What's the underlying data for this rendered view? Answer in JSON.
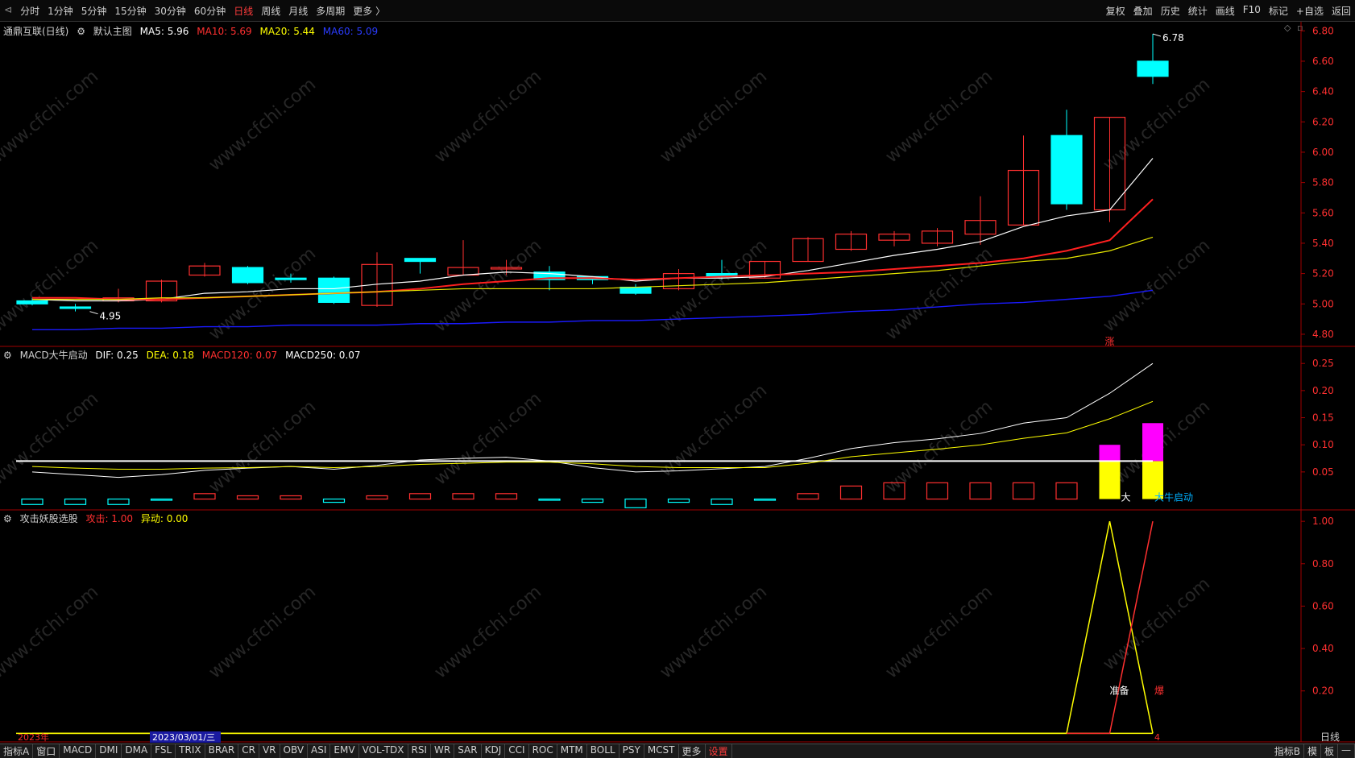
{
  "toolbar": {
    "periods": [
      "分时",
      "1分钟",
      "5分钟",
      "15分钟",
      "30分钟",
      "60分钟",
      "日线",
      "周线",
      "月线",
      "多周期",
      "更多 〉"
    ],
    "active_period": "日线",
    "right": [
      "复权",
      "叠加",
      "历史",
      "统计",
      "画线",
      "F10",
      "标记",
      "+自选",
      "返回"
    ]
  },
  "main_panel": {
    "stock": "通鼎互联(日线)",
    "template": "默认主图",
    "ma": [
      {
        "label": "MA5: 5.96",
        "color": "#ffffff"
      },
      {
        "label": "MA10: 5.69",
        "color": "#ff3030"
      },
      {
        "label": "MA20: 5.44",
        "color": "#ffff00"
      },
      {
        "label": "MA60: 5.09",
        "color": "#2a3cff"
      }
    ],
    "y_ticks": [
      "6.80",
      "6.60",
      "6.40",
      "6.20",
      "6.00",
      "5.80",
      "5.60",
      "5.40",
      "5.20",
      "5.00",
      "4.80"
    ],
    "high_label": "6.78",
    "low_label": "4.95",
    "mark_zhang": "涨"
  },
  "macd_panel": {
    "name": "MACD大牛启动",
    "dif": "DIF: 0.25",
    "dea": "DEA: 0.18",
    "macd120": "MACD120: 0.07",
    "macd250": "MACD250: 0.07",
    "y_ticks": [
      "0.25",
      "0.20",
      "0.15",
      "0.10",
      "0.05"
    ],
    "label_da": "大",
    "label_start": "大牛启动"
  },
  "attack_panel": {
    "name": "攻击妖股选股",
    "attack": "攻击: 1.00",
    "abnormal": "异动: 0.00",
    "y_ticks": [
      "1.00",
      "0.80",
      "0.60",
      "0.40",
      "0.20"
    ],
    "label_ready": "准备",
    "label_burst": "爆"
  },
  "x_axis": {
    "year": "2023年",
    "cursor_date": "2023/03/01/三",
    "month": "4",
    "period_label": "日线"
  },
  "bottom_tabs": [
    "指标A",
    "窗口",
    "MACD",
    "DMI",
    "DMA",
    "FSL",
    "TRIX",
    "BRAR",
    "CR",
    "VR",
    "OBV",
    "ASI",
    "EMV",
    "VOL-TDX",
    "RSI",
    "WR",
    "SAR",
    "KDJ",
    "CCI",
    "ROC",
    "MTM",
    "BOLL",
    "PSY",
    "MCST",
    "更多",
    "设置"
  ],
  "bottom_right": [
    "指标B",
    "模",
    "板",
    "—"
  ],
  "watermark": "www.cfchi.com",
  "colors": {
    "up": "#ff3030",
    "down": "#00ffff",
    "ma5": "#ffffff",
    "ma10": "#ff2020",
    "ma20": "#e8e800",
    "ma60": "#1a1aff"
  },
  "chart_data": [
    {
      "type": "candlestick",
      "series_name": "通鼎互联(日线)",
      "ylim": [
        4.72,
        6.86
      ],
      "candles": [
        {
          "o": 5.02,
          "h": 5.04,
          "l": 4.99,
          "c": 5.0
        },
        {
          "o": 4.98,
          "h": 5.0,
          "l": 4.95,
          "c": 4.97
        },
        {
          "o": 5.02,
          "h": 5.1,
          "l": 5.01,
          "c": 5.04
        },
        {
          "o": 5.02,
          "h": 5.16,
          "l": 5.01,
          "c": 5.15
        },
        {
          "o": 5.19,
          "h": 5.27,
          "l": 5.18,
          "c": 5.25
        },
        {
          "o": 5.24,
          "h": 5.25,
          "l": 5.13,
          "c": 5.14
        },
        {
          "o": 5.17,
          "h": 5.2,
          "l": 5.14,
          "c": 5.16
        },
        {
          "o": 5.17,
          "h": 5.18,
          "l": 5.0,
          "c": 5.01
        },
        {
          "o": 4.99,
          "h": 5.34,
          "l": 4.98,
          "c": 5.26
        },
        {
          "o": 5.3,
          "h": 5.3,
          "l": 5.2,
          "c": 5.28
        },
        {
          "o": 5.19,
          "h": 5.42,
          "l": 5.19,
          "c": 5.24
        },
        {
          "o": 5.23,
          "h": 5.29,
          "l": 5.19,
          "c": 5.24
        },
        {
          "o": 5.21,
          "h": 5.25,
          "l": 5.09,
          "c": 5.16
        },
        {
          "o": 5.18,
          "h": 5.18,
          "l": 5.13,
          "c": 5.16
        },
        {
          "o": 5.11,
          "h": 5.13,
          "l": 5.06,
          "c": 5.07
        },
        {
          "o": 5.1,
          "h": 5.23,
          "l": 5.09,
          "c": 5.2
        },
        {
          "o": 5.2,
          "h": 5.29,
          "l": 5.16,
          "c": 5.18
        },
        {
          "o": 5.17,
          "h": 5.28,
          "l": 5.17,
          "c": 5.28
        },
        {
          "o": 5.28,
          "h": 5.44,
          "l": 5.28,
          "c": 5.43
        },
        {
          "o": 5.36,
          "h": 5.48,
          "l": 5.35,
          "c": 5.46
        },
        {
          "o": 5.42,
          "h": 5.48,
          "l": 5.38,
          "c": 5.46
        },
        {
          "o": 5.4,
          "h": 5.5,
          "l": 5.38,
          "c": 5.48
        },
        {
          "o": 5.46,
          "h": 5.71,
          "l": 5.39,
          "c": 5.55
        },
        {
          "o": 5.52,
          "h": 6.11,
          "l": 5.52,
          "c": 5.88
        },
        {
          "o": 6.11,
          "h": 6.28,
          "l": 5.62,
          "c": 5.66
        },
        {
          "o": 5.62,
          "h": 6.23,
          "l": 5.54,
          "c": 6.23
        },
        {
          "o": 6.6,
          "h": 6.78,
          "l": 6.45,
          "c": 6.5
        }
      ],
      "ma": {
        "MA5": [
          5.03,
          5.02,
          5.02,
          5.03,
          5.07,
          5.08,
          5.1,
          5.1,
          5.13,
          5.15,
          5.19,
          5.21,
          5.2,
          5.18,
          5.15,
          5.17,
          5.17,
          5.18,
          5.22,
          5.27,
          5.32,
          5.36,
          5.41,
          5.51,
          5.58,
          5.62,
          5.96
        ],
        "MA10": [
          5.04,
          5.04,
          5.03,
          5.03,
          5.04,
          5.05,
          5.06,
          5.07,
          5.08,
          5.1,
          5.13,
          5.15,
          5.17,
          5.17,
          5.16,
          5.17,
          5.18,
          5.19,
          5.2,
          5.21,
          5.23,
          5.25,
          5.27,
          5.3,
          5.35,
          5.42,
          5.69
        ],
        "MA20": [
          5.03,
          5.03,
          5.03,
          5.04,
          5.04,
          5.05,
          5.06,
          5.07,
          5.08,
          5.09,
          5.1,
          5.1,
          5.1,
          5.1,
          5.11,
          5.12,
          5.13,
          5.14,
          5.16,
          5.18,
          5.2,
          5.22,
          5.25,
          5.28,
          5.3,
          5.35,
          5.44
        ],
        "MA60": [
          4.83,
          4.83,
          4.84,
          4.84,
          4.85,
          4.85,
          4.86,
          4.86,
          4.86,
          4.87,
          4.87,
          4.88,
          4.88,
          4.89,
          4.89,
          4.9,
          4.91,
          4.92,
          4.93,
          4.95,
          4.96,
          4.98,
          5.0,
          5.01,
          5.03,
          5.05,
          5.09
        ]
      }
    },
    {
      "type": "bar",
      "series_name": "MACD大牛启动",
      "ylim": [
        -0.02,
        0.28
      ],
      "macd": [
        -0.01,
        -0.01,
        -0.01,
        -0.002,
        0.01,
        0.006,
        0.006,
        -0.006,
        0.006,
        0.01,
        0.01,
        0.01,
        -0.002,
        -0.006,
        -0.016,
        -0.006,
        -0.01,
        -0.002,
        0.01,
        0.024,
        0.03,
        0.03,
        0.03,
        0.03,
        0.03,
        0.05,
        0.06
      ],
      "dif": [
        0.05,
        0.045,
        0.04,
        0.045,
        0.053,
        0.057,
        0.06,
        0.055,
        0.062,
        0.072,
        0.075,
        0.077,
        0.07,
        0.058,
        0.05,
        0.052,
        0.056,
        0.06,
        0.075,
        0.093,
        0.104,
        0.111,
        0.121,
        0.14,
        0.15,
        0.195,
        0.25
      ],
      "dea": [
        0.06,
        0.057,
        0.055,
        0.055,
        0.057,
        0.058,
        0.06,
        0.058,
        0.06,
        0.064,
        0.066,
        0.068,
        0.068,
        0.065,
        0.06,
        0.058,
        0.058,
        0.058,
        0.066,
        0.078,
        0.085,
        0.092,
        0.1,
        0.112,
        0.122,
        0.148,
        0.18
      ],
      "macd120": 0.07,
      "big_bull_bars": [
        {
          "index": 25,
          "yellow": 0.07,
          "magenta": 0.1
        },
        {
          "index": 26,
          "yellow": 0.07,
          "magenta": 0.14
        }
      ]
    },
    {
      "type": "line",
      "series_name": "攻击妖股选股",
      "ylim": [
        -0.01,
        1.05
      ],
      "series": [
        {
          "name": "攻击",
          "values": [
            0,
            0,
            0,
            0,
            0,
            0,
            0,
            0,
            0,
            0,
            0,
            0,
            0,
            0,
            0,
            0,
            0,
            0,
            0,
            0,
            0,
            0,
            0,
            0,
            0,
            0,
            1.0
          ]
        },
        {
          "name": "异动",
          "values": [
            0,
            0,
            0,
            0,
            0,
            0,
            0,
            0,
            0,
            0,
            0,
            0,
            0,
            0,
            0,
            0,
            0,
            0,
            0,
            0,
            0,
            0,
            0,
            0,
            0,
            1.0,
            0
          ]
        }
      ]
    }
  ]
}
